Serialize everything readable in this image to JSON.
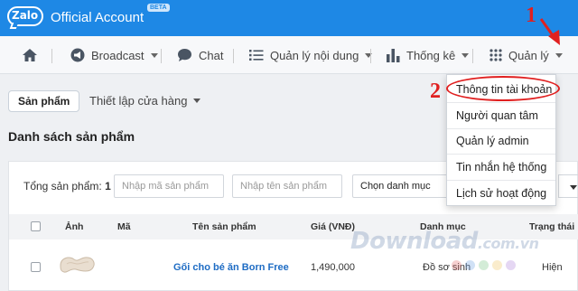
{
  "brand": {
    "logo_text": "Zalo",
    "name": "Official Account",
    "beta": "BETA"
  },
  "nav": {
    "items": [
      {
        "label": "Broadcast",
        "icon": "megaphone-icon"
      },
      {
        "label": "Chat",
        "icon": "chat-bubble-icon"
      },
      {
        "label": "Quản lý nội dung",
        "icon": "list-icon"
      },
      {
        "label": "Thống kê",
        "icon": "bar-chart-icon"
      },
      {
        "label": "Quản lý",
        "icon": "grid-icon"
      }
    ],
    "home_icon": "home-icon"
  },
  "toolbar": {
    "product_tab": "Sản phẩm",
    "store_setup": "Thiết lập cửa hàng"
  },
  "page_title": "Danh sách sản phẩm",
  "filters": {
    "total_label": "Tổng sản phẩm:",
    "total_value": "1",
    "code_placeholder": "Nhập mã sản phẩm",
    "name_placeholder": "Nhập tên sản phẩm",
    "category_select": "Chọn danh mục"
  },
  "table": {
    "headers": [
      "Ảnh",
      "Mã",
      "Tên sản phẩm",
      "Giá (VNĐ)",
      "Danh mục",
      "Trạng thái"
    ],
    "rows": [
      {
        "code": "",
        "name": "Gối cho bé ăn Born Free",
        "price": "1,490,000",
        "category": "Đồ sơ sinh",
        "status": "Hiện"
      }
    ]
  },
  "dropdown": {
    "items": [
      "Thông tin tài khoản",
      "Người quan tâm",
      "Quản lý admin",
      "Tin nhắn hệ thống",
      "Lịch sử hoạt động"
    ]
  },
  "annotations": {
    "step1": "1",
    "step2": "2"
  },
  "watermark": {
    "text": "Download",
    "suffix": ".com.vn"
  },
  "colors": {
    "brand_blue": "#1e88e5",
    "annotation_red": "#e02020",
    "link_blue": "#1e6cc4"
  }
}
